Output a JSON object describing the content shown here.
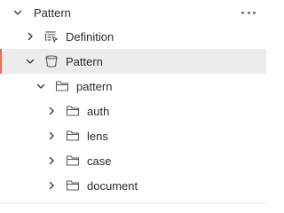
{
  "section": {
    "title": "Pattern",
    "more_icon": "more-horizontal-icon"
  },
  "tree": {
    "definition": {
      "label": "Definition",
      "icon": "definition-list-icon"
    },
    "pattern_root": {
      "label": "Pattern",
      "icon": "bucket-icon"
    },
    "pattern_folder": {
      "label": "pattern",
      "icon": "folder-icon"
    },
    "children": [
      {
        "label": "auth",
        "icon": "folder-icon"
      },
      {
        "label": "lens",
        "icon": "folder-icon"
      },
      {
        "label": "case",
        "icon": "folder-icon"
      },
      {
        "label": "document",
        "icon": "folder-icon"
      }
    ]
  },
  "colors": {
    "accent": "#ee6c4d",
    "selected_bg": "#ececec"
  }
}
